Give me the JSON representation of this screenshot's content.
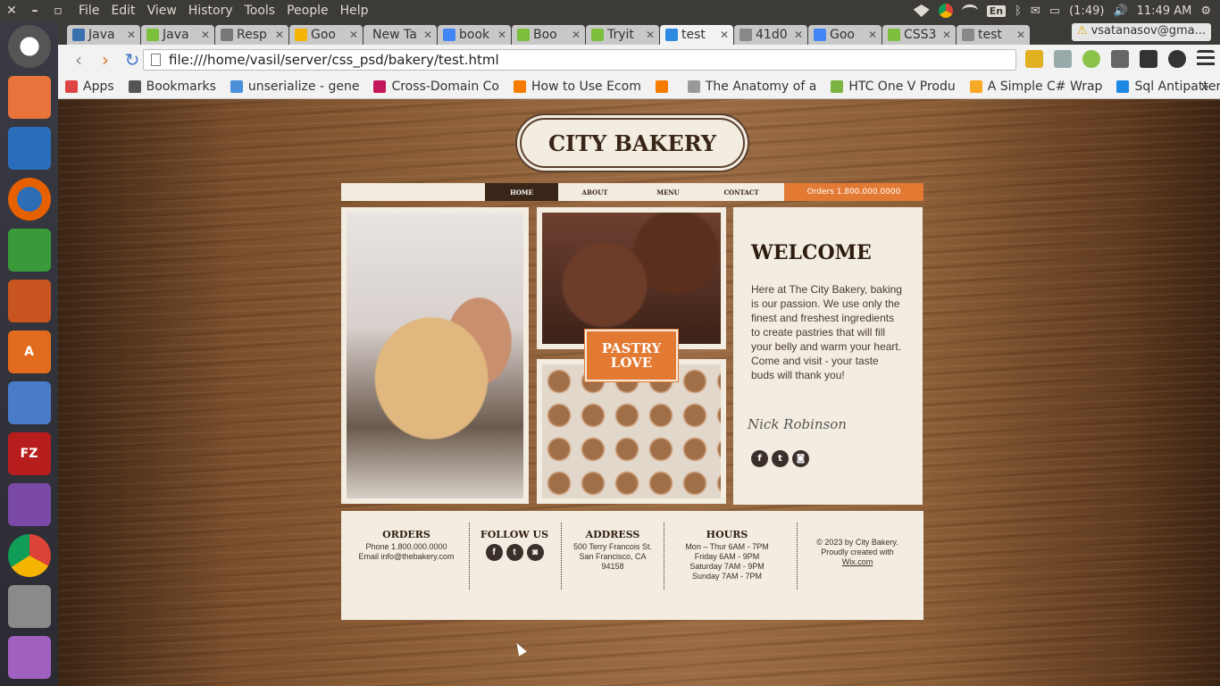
{
  "system": {
    "menu": [
      "File",
      "Edit",
      "View",
      "History",
      "Tools",
      "People",
      "Help"
    ],
    "lang": "En",
    "battery": "(1:49)",
    "time": "11:49 AM"
  },
  "browser": {
    "tabs": [
      {
        "label": "Java",
        "color": "#3a6fb0"
      },
      {
        "label": "Java",
        "color": "#7bbf3b"
      },
      {
        "label": "Resp",
        "color": "#777777"
      },
      {
        "label": "Goo",
        "color": "#f4b400"
      },
      {
        "label": "New Ta",
        "color": ""
      },
      {
        "label": "book",
        "color": "#4285f4"
      },
      {
        "label": "Boo",
        "color": "#7bbf3b"
      },
      {
        "label": "Tryit",
        "color": "#7bbf3b"
      },
      {
        "label": "test",
        "color": "#2c8be0"
      },
      {
        "label": "41d0",
        "color": "#888888"
      },
      {
        "label": "Goo",
        "color": "#4285f4"
      },
      {
        "label": "CSS3",
        "color": "#7bbf3b"
      },
      {
        "label": "test",
        "color": "#888888"
      }
    ],
    "profile": "vsatanasov@gma...",
    "url": "file:///home/vasil/server/css_psd/bakery/test.html",
    "bookmarks": [
      {
        "label": "Apps",
        "color": "#d44"
      },
      {
        "label": "Bookmarks",
        "color": "#555"
      },
      {
        "label": "unserialize - gene",
        "color": "#4a90d9"
      },
      {
        "label": "Cross-Domain Co",
        "color": "#c2185b"
      },
      {
        "label": "How to Use Ecom",
        "color": "#f57c00"
      },
      {
        "label": "",
        "color": "#f57c00"
      },
      {
        "label": "The Anatomy of a",
        "color": "#999"
      },
      {
        "label": "HTC One V Produ",
        "color": "#7cb342"
      },
      {
        "label": "A Simple C# Wrap",
        "color": "#f9a825"
      },
      {
        "label": "Sql Antipatterns",
        "color": "#1e88e5"
      }
    ]
  },
  "site": {
    "brand": "CITY BAKERY",
    "nav": {
      "items": [
        "HOME",
        "ABOUT",
        "MENU",
        "CONTACT"
      ],
      "active_index": 0,
      "orders": "Orders 1.800.000.0000"
    },
    "banner_line1": "PASTRY",
    "banner_line2": "LOVE",
    "welcome": {
      "title": "WELCOME",
      "body": "Here at The City Bakery, baking is our passion. We use only the finest and freshest ingredients to create pastries that will fill your belly and warm your heart. Come and visit - your taste buds will thank you!",
      "signature": "Nick Robinson"
    },
    "footer": {
      "orders": {
        "title": "ORDERS",
        "phone": "Phone 1.800.000.0000",
        "email": "Email info@thebakery.com"
      },
      "follow": {
        "title": "FOLLOW US"
      },
      "address": {
        "title": "ADDRESS",
        "line1": "500 Terry Francois St.",
        "line2": "San Francisco, CA",
        "line3": "94158"
      },
      "hours": {
        "title": "HOURS",
        "line1": "Mon – Thur  6AM - 7PM",
        "line2": "Friday  6AM - 9PM",
        "line3": "Saturday  7AM - 9PM",
        "line4": "Sunday  7AM - 7PM"
      },
      "copyright": {
        "line1": "© 2023 by City Bakery.",
        "line2": "Proudly created with",
        "link": "Wix.com"
      }
    }
  }
}
